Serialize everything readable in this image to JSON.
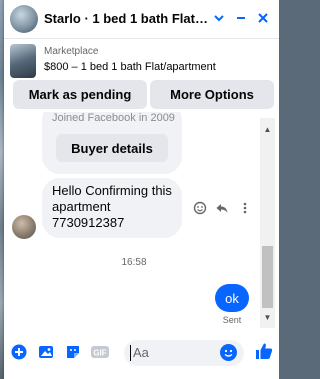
{
  "header": {
    "title": "Starlo · 1 bed 1 bath Flat/a...",
    "actions": [
      "chevron-down-icon",
      "minimize-icon",
      "close-icon"
    ]
  },
  "listing": {
    "label": "Marketplace",
    "subtitle": "$800 – 1 bed 1 bath Flat/apartment"
  },
  "actions": {
    "mark_pending": "Mark as pending",
    "more_options": "More Options"
  },
  "messages": {
    "previous_text": "Joined Facebook in 2009",
    "buyer_details": "Buyer details",
    "incoming_text": "Hello Confirming this\napartment\n7730912387",
    "timestamp": "16:58",
    "outgoing_text": "ok",
    "outgoing_status": "Sent"
  },
  "composer": {
    "placeholder": "Aa",
    "icons": [
      "plus-icon",
      "photo-icon",
      "sticker-icon",
      "gif-icon",
      "emoji-icon",
      "like-icon"
    ]
  },
  "colors": {
    "accent": "#0866ff",
    "bubble": "#f0f2f5",
    "button": "#e4e6eb"
  }
}
